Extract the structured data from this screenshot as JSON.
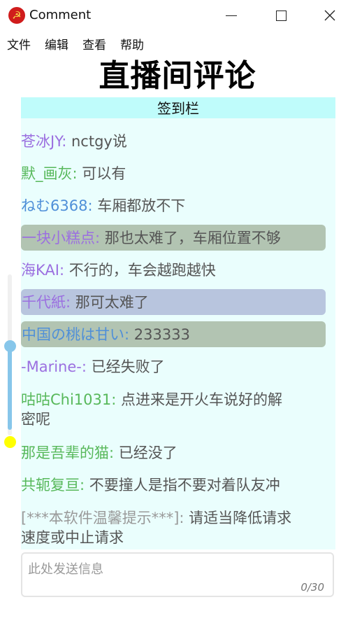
{
  "window": {
    "title": "Comment"
  },
  "menu": [
    "文件",
    "编辑",
    "查看",
    "帮助"
  ],
  "heading": "直播间评论",
  "signin_bar": "签到栏",
  "messages": [
    {
      "user": "苍冰JY",
      "sep": ": ",
      "text": "nctgy说",
      "user_color": "#9b6fe0"
    },
    {
      "user": "默_画灰",
      "sep": ": ",
      "text": "可以有",
      "user_color": "#57b85a"
    },
    {
      "user": "ねむ6368",
      "sep": ": ",
      "text": "车厢都放不下",
      "user_color": "#4f8fd8"
    },
    {
      "user": "一块小糕点",
      "sep": ": ",
      "text": "那也太难了，车厢位置不够",
      "user_color": "#9b6fe0",
      "highlight": "#b2c4b2"
    },
    {
      "user": "海KAI",
      "sep": ": ",
      "text": "不行的，车会越跑越快",
      "user_color": "#9b6fe0"
    },
    {
      "user": "千代紙",
      "sep": ": ",
      "text": "那可太难了",
      "user_color": "#9b6fe0",
      "highlight": "#b8c5de"
    },
    {
      "user": "中国の桃は甘い",
      "sep": ": ",
      "text": "233333",
      "user_color": "#4f8fd8",
      "highlight": "#b2c4b2"
    },
    {
      "user": "-Marine-",
      "sep": ": ",
      "text": "已经失败了",
      "user_color": "#9b6fe0"
    },
    {
      "user": "咕咕Chi1031",
      "sep": ": ",
      "text": "点进来是开火车说好的解",
      "text2": "密呢",
      "user_color": "#57b85a"
    },
    {
      "user": "那是吾辈的猫",
      "sep": ": ",
      "text": "已经没了",
      "user_color": "#57b85a"
    },
    {
      "user": "共轭复亘",
      "sep": ": ",
      "text": "不要撞人是指不要对着队友冲",
      "user_color": "#57b85a"
    },
    {
      "user": "[***本软件温馨提示***]",
      "sep": ": ",
      "text": "请适当降低请求",
      "text2": "速度或中止请求",
      "user_color": "#999999"
    }
  ],
  "input": {
    "placeholder": "此处发送信息",
    "counter": "0/30"
  },
  "slider": {
    "value": 0.45
  },
  "colors": {
    "chat_bg": "#eafefd",
    "signin_bg": "#bffcfb",
    "slider": "#87c6ea",
    "status_dot": "#ffff00"
  },
  "icons": {
    "app": "hammer-sickle-icon",
    "minimize": "minimize-icon",
    "maximize": "maximize-icon",
    "close": "close-icon"
  }
}
